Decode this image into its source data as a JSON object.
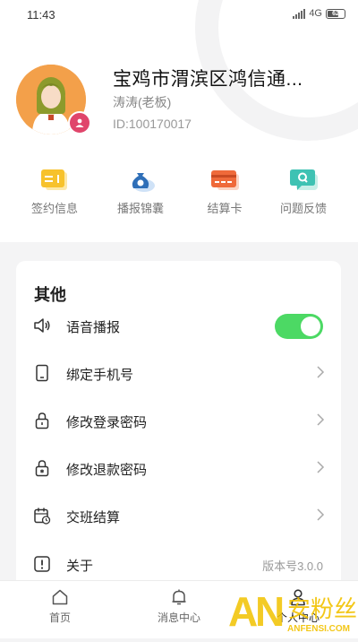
{
  "status_bar": {
    "time": "11:43",
    "network": "4G",
    "battery": "62"
  },
  "profile": {
    "shop_name": "宝鸡市渭滨区鸿信通...",
    "owner": "涛涛(老板)",
    "id": "ID:100170017"
  },
  "quick_actions": [
    {
      "label": "签约信息",
      "icon": "contract-icon"
    },
    {
      "label": "播报锦囊",
      "icon": "money-bag-icon"
    },
    {
      "label": "结算卡",
      "icon": "card-icon"
    },
    {
      "label": "问题反馈",
      "icon": "feedback-icon"
    }
  ],
  "settings": {
    "title": "其他",
    "items": [
      {
        "label": "语音播报",
        "icon": "speaker-icon",
        "toggle_on": true
      },
      {
        "label": "绑定手机号",
        "icon": "phone-icon"
      },
      {
        "label": "修改登录密码",
        "icon": "lock-icon"
      },
      {
        "label": "修改退款密码",
        "icon": "lock-asterisk-icon"
      },
      {
        "label": "交班结算",
        "icon": "calendar-clock-icon"
      },
      {
        "label": "关于",
        "icon": "info-icon",
        "value": "版本号3.0.0"
      }
    ]
  },
  "tabs": [
    {
      "label": "首页",
      "icon": "home-icon"
    },
    {
      "label": "消息中心",
      "icon": "bell-icon"
    },
    {
      "label": "个人中心",
      "icon": "person-icon",
      "active": true
    }
  ],
  "watermark": {
    "big": "安粉丝",
    "small": "ANFENSI.COM"
  },
  "colors": {
    "toggle_on": "#4cd964",
    "avatar_bg": "#f3a04a",
    "badge": "#e0456b",
    "page_bg": "#f4f4f5"
  }
}
